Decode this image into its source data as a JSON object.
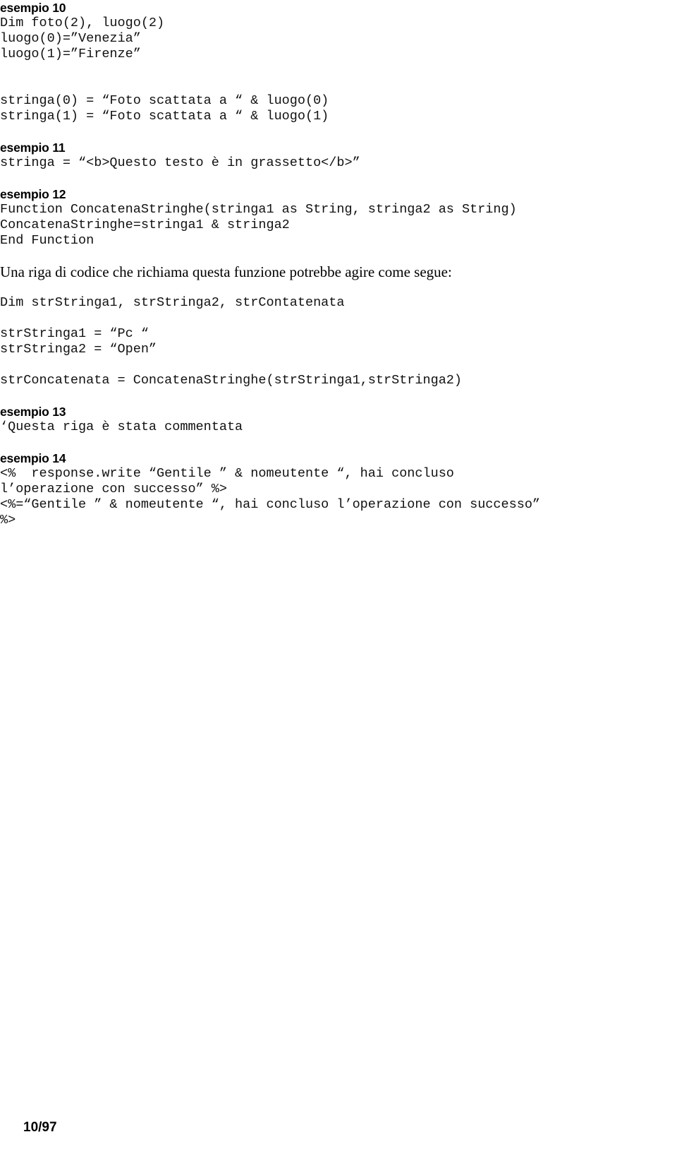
{
  "document": {
    "page_label": "10/97",
    "background_color": "#ffffff",
    "text_color": "#000000"
  },
  "blocks": [
    {
      "kind": "heading",
      "indent": "indent-0",
      "text": "esempio 10"
    },
    {
      "kind": "code",
      "indent": "indent-0",
      "text": "Dim foto(2), luogo(2)"
    },
    {
      "kind": "code",
      "indent": "indent-0",
      "text": "luogo(0)=”Venezia”"
    },
    {
      "kind": "code",
      "indent": "indent-0",
      "text": "luogo(1)=”Firenze”"
    },
    {
      "kind": "blank",
      "indent": "indent-0",
      "text": ""
    },
    {
      "kind": "blank",
      "indent": "indent-0",
      "text": ""
    },
    {
      "kind": "code",
      "indent": "indent-1",
      "text": "stringa(0) = “Foto scattata a “ & luogo(0)"
    },
    {
      "kind": "code",
      "indent": "indent-1",
      "text": "stringa(1) = “Foto scattata a “ & luogo(1)"
    },
    {
      "kind": "blank",
      "indent": "indent-0",
      "text": ""
    },
    {
      "kind": "heading",
      "indent": "indent-1",
      "text": "esempio 11"
    },
    {
      "kind": "code",
      "indent": "indent-1",
      "text": "stringa = “<b>Questo testo è in grassetto</b>”"
    },
    {
      "kind": "blank",
      "indent": "indent-0",
      "text": ""
    },
    {
      "kind": "heading",
      "indent": "indent-0",
      "text": "esempio 12"
    },
    {
      "kind": "code",
      "indent": "indent-0",
      "text": "Function ConcatenaStringhe(stringa1 as String, stringa2 as String)"
    },
    {
      "kind": "code",
      "indent": "indent-fn",
      "text": "ConcatenaStringhe=stringa1 & stringa2"
    },
    {
      "kind": "code",
      "indent": "indent-0",
      "text": "End Function"
    },
    {
      "kind": "blank",
      "indent": "indent-0",
      "text": ""
    },
    {
      "kind": "prose",
      "indent": "indent-2",
      "text": "Una riga di codice che richiama questa funzione potrebbe agire come segue:"
    },
    {
      "kind": "blank",
      "indent": "indent-0",
      "text": ""
    },
    {
      "kind": "code",
      "indent": "indent-0",
      "text": "Dim strStringa1, strStringa2, strContatenata"
    },
    {
      "kind": "blank",
      "indent": "indent-0",
      "text": ""
    },
    {
      "kind": "code",
      "indent": "indent-0",
      "text": "strStringa1 = “Pc “"
    },
    {
      "kind": "code",
      "indent": "indent-0",
      "text": "strStringa2 = “Open”"
    },
    {
      "kind": "blank",
      "indent": "indent-0",
      "text": ""
    },
    {
      "kind": "code",
      "indent": "indent-0",
      "text": "strConcatenata = ConcatenaStringhe(strStringa1,strStringa2)"
    },
    {
      "kind": "blank",
      "indent": "indent-0",
      "text": ""
    },
    {
      "kind": "heading",
      "indent": "indent-0",
      "text": "esempio 13"
    },
    {
      "kind": "code",
      "indent": "indent-0",
      "text": "‘Questa riga è stata commentata"
    },
    {
      "kind": "blank",
      "indent": "indent-0",
      "text": ""
    },
    {
      "kind": "heading",
      "indent": "indent-0",
      "text": "esempio 14"
    },
    {
      "kind": "code",
      "indent": "indent-0",
      "text": "<%  response.write “Gentile ” & nomeutente “, hai concluso"
    },
    {
      "kind": "code",
      "indent": "indent-0",
      "text": "l’operazione con successo” %>"
    },
    {
      "kind": "code",
      "indent": "indent-0",
      "text": "<%=“Gentile ” & nomeutente “, hai concluso l’operazione con successo”"
    },
    {
      "kind": "code",
      "indent": "indent-0",
      "text": "%>"
    }
  ]
}
